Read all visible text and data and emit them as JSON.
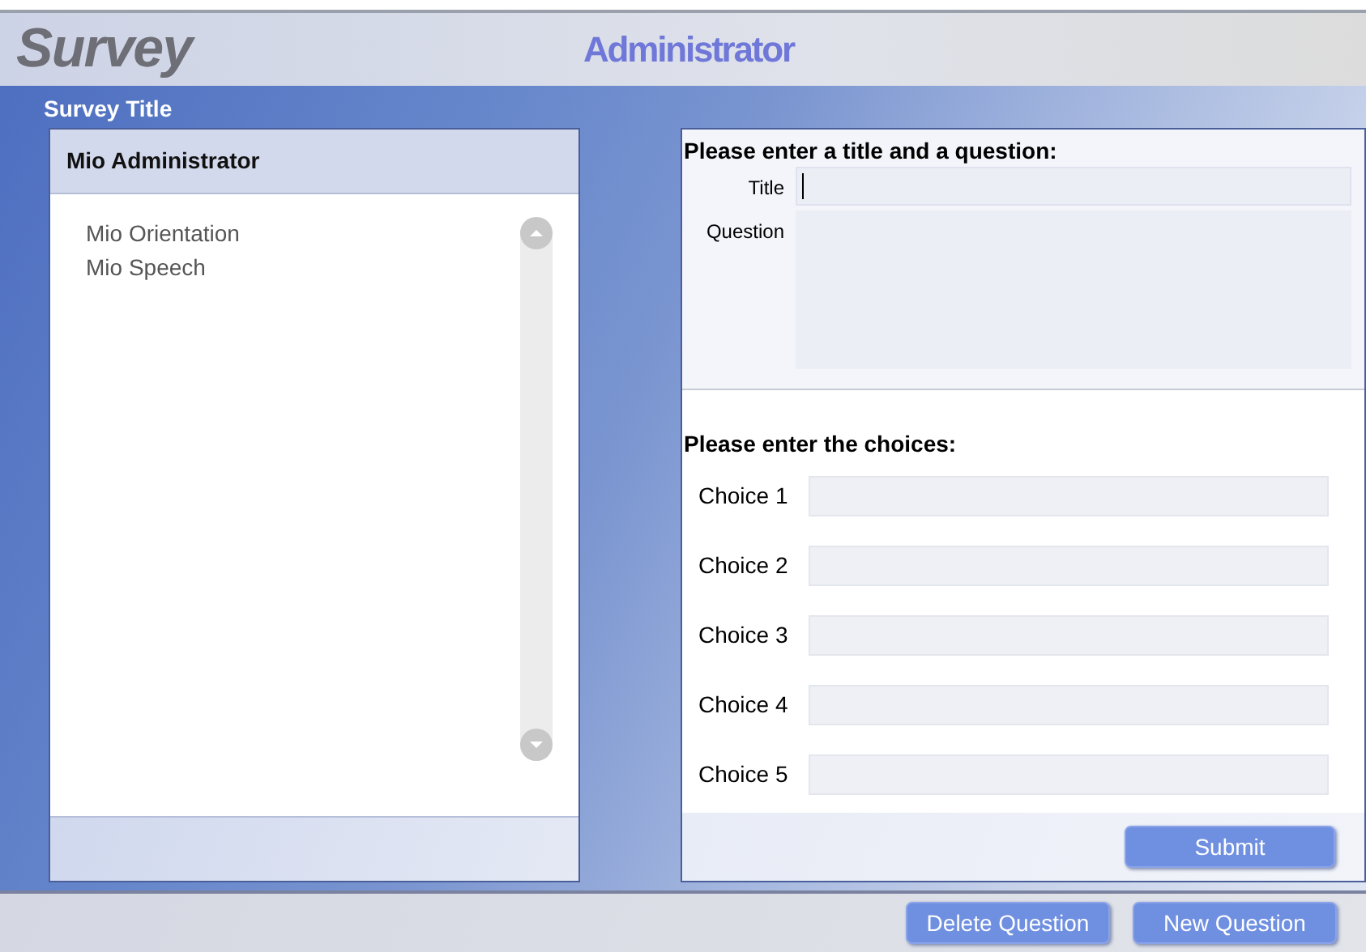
{
  "header": {
    "logo": "Survey",
    "title": "Administrator"
  },
  "survey_panel": {
    "label": "Survey Title",
    "heading": "Mio Administrator",
    "items": [
      "Mio Orientation",
      "Mio Speech"
    ]
  },
  "question_form": {
    "heading": "Please enter a title and a question:",
    "fields": [
      {
        "label": "Title",
        "kind": "line",
        "focused": true
      },
      {
        "label": "Question",
        "kind": "area",
        "focused": false
      }
    ]
  },
  "choices_form": {
    "heading": "Please enter the choices:",
    "choices": [
      {
        "label": "Choice 1"
      },
      {
        "label": "Choice 2"
      },
      {
        "label": "Choice 3"
      },
      {
        "label": "Choice 4"
      },
      {
        "label": "Choice 5"
      }
    ],
    "submit": "Submit"
  },
  "footer_buttons": [
    "Delete Question",
    "New Question"
  ]
}
